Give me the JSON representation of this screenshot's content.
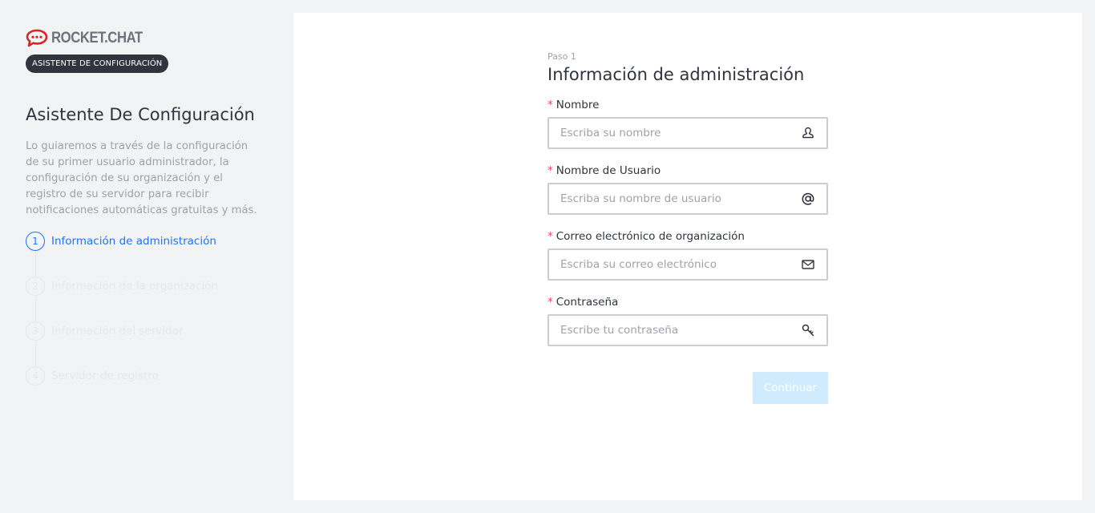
{
  "sidebar": {
    "logo_text": "ROCKET.CHAT",
    "badge": "ASISTENTE DE CONFIGURACIÓN",
    "title": "Asistente De Configuración",
    "description": "Lo guiaremos a través de la configuración de su primer usuario administrador, la configuración de su organización y el registro de su servidor para recibir notificaciones automáticas gratuitas y más.",
    "steps": [
      {
        "number": "1",
        "label": "Información de administración",
        "active": true
      },
      {
        "number": "2",
        "label": "Información de la organización",
        "active": false
      },
      {
        "number": "3",
        "label": "Información del servidor",
        "active": false
      },
      {
        "number": "4",
        "label": "Servidor de registro",
        "active": false
      }
    ]
  },
  "form": {
    "step_caption": "Paso 1",
    "title": "Información de administración",
    "required_marker": "*",
    "fields": [
      {
        "label": "Nombre",
        "placeholder": "Escriba su nombre",
        "value": "",
        "icon": "user-icon"
      },
      {
        "label": "Nombre de Usuario",
        "placeholder": "Escriba su nombre de usuario",
        "value": "",
        "icon": "at-icon"
      },
      {
        "label": "Correo electrónico de organización",
        "placeholder": "Escriba su correo electrónico",
        "value": "",
        "icon": "mail-icon"
      },
      {
        "label": "Contraseña",
        "placeholder": "Escribe tu contraseña",
        "value": "",
        "icon": "key-icon"
      }
    ],
    "continue_label": "Continuar"
  },
  "colors": {
    "accent": "#1d74f5",
    "brand_red": "#db2323",
    "required": "#f5455c",
    "button_disabled": "#d1ebfe"
  }
}
